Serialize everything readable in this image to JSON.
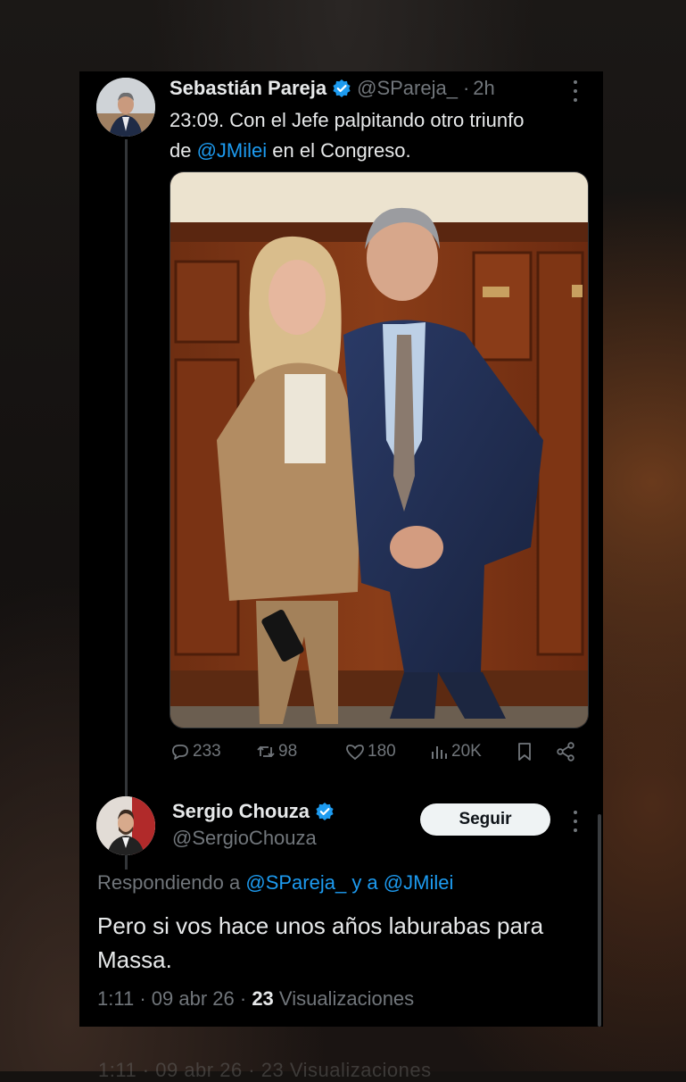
{
  "original_tweet": {
    "author_name": "Sebastián Pareja",
    "handle": "@SPareja_",
    "separator": "·",
    "time": "2h",
    "text_line1": "23:09. Con el Jefe palpitando otro triunfo",
    "text_prefix": "de ",
    "mention": "@JMilei",
    "text_suffix": " en el Congreso.",
    "stats": {
      "replies": "233",
      "reposts": "98",
      "likes": "180",
      "views": "20K"
    }
  },
  "reply": {
    "author_name": "Sergio Chouza",
    "handle": "@SergioChouza",
    "follow_label": "Seguir",
    "replying_prefix": "Respondiendo a ",
    "replying_mention1": "@SPareja_",
    "replying_joiner": " y a ",
    "replying_mention2": "@JMilei",
    "text": "Pero si vos hace unos años laburabas para Massa.",
    "time": "1:11",
    "date": "09 abr 26",
    "dot": "·",
    "views_count": "23",
    "views_label": "Visualizaciones"
  },
  "ghost_text": "1:11 · 09 abr 26 · 23 Visualizaciones",
  "colors": {
    "background": "#000000",
    "text": "#e7e9ea",
    "secondary": "#71767b",
    "accent": "#1d9bf0",
    "button_bg": "#eff3f4"
  }
}
